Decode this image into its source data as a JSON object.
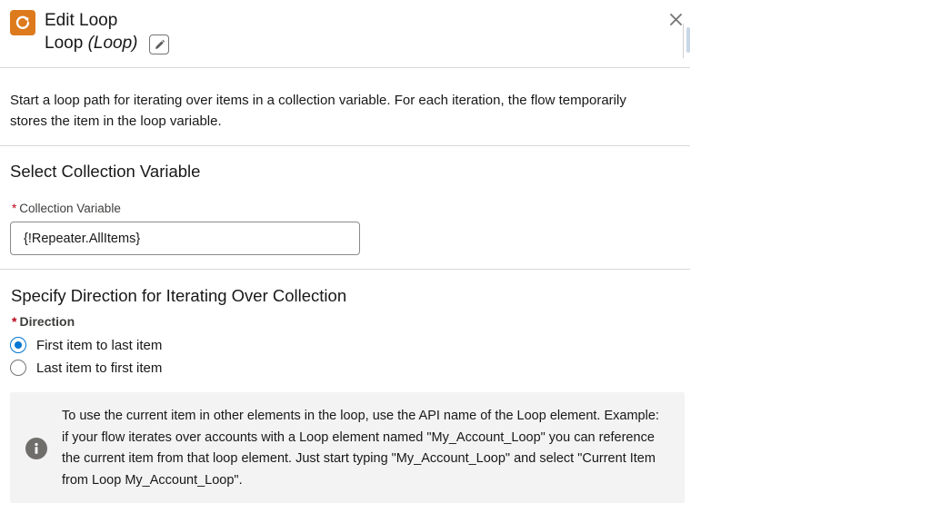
{
  "header": {
    "title": "Edit Loop",
    "element_name": "Loop",
    "element_type": "(Loop)",
    "icons": {
      "app": "loop-refresh-icon",
      "edit": "pencil-icon",
      "close": "close-icon"
    },
    "accent_color": "#dd7a1c"
  },
  "description": "Start a loop path for iterating over items in a collection variable. For each iteration, the flow temporarily stores the item in the loop variable.",
  "collection_section": {
    "title": "Select Collection Variable",
    "field_label": "Collection Variable",
    "required_marker": "*",
    "value": "{!Repeater.AllItems}"
  },
  "direction_section": {
    "title": "Specify Direction for Iterating Over Collection",
    "label": "Direction",
    "required_marker": "*",
    "options": [
      {
        "label": "First item to last item",
        "selected": true
      },
      {
        "label": "Last item to first item",
        "selected": false
      }
    ]
  },
  "info": {
    "icon": "info-icon",
    "text": "To use the current item in other elements in the loop, use the API name of the Loop element. Example: if your flow iterates over accounts with a Loop element named \"My_Account_Loop\" you can reference the current item from that loop element. Just start typing \"My_Account_Loop\" and select \"Current Item from Loop My_Account_Loop\"."
  }
}
